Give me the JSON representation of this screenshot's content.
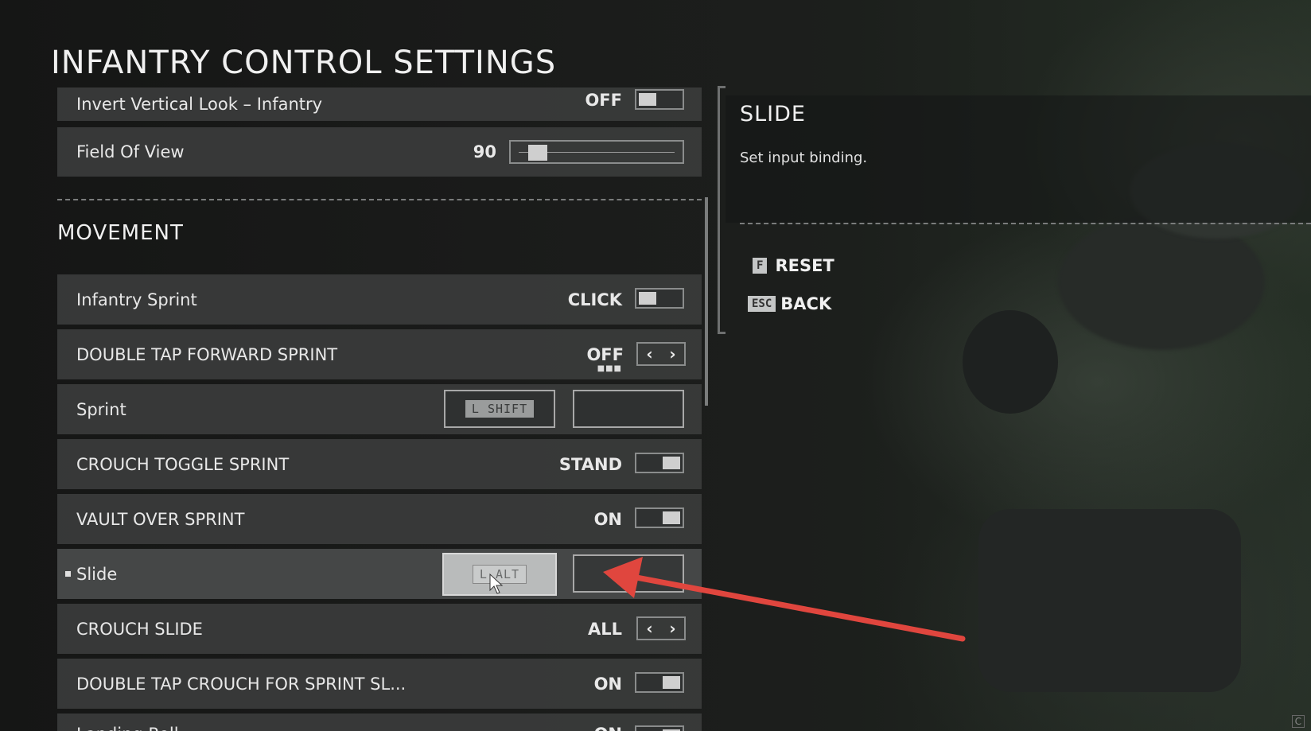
{
  "page": {
    "title": "INFANTRY CONTROL SETTINGS"
  },
  "rows_top": [
    {
      "label": "Invert Vertical Look – Infantry",
      "value": "OFF",
      "control": "toggle",
      "on": false
    },
    {
      "label": "Field Of View",
      "value": "90",
      "control": "slider",
      "level_fraction": 0.12
    }
  ],
  "section": {
    "title": "MOVEMENT"
  },
  "rows": [
    {
      "label": "Infantry Sprint",
      "value": "CLICK",
      "control": "toggle",
      "on": false
    },
    {
      "label": "DOUBLE TAP FORWARD SPRINT",
      "value": "OFF",
      "control": "arrows"
    },
    {
      "label": "Sprint",
      "control": "keybind",
      "primary_key": "L SHIFT",
      "secondary_key": ""
    },
    {
      "label": "CROUCH TOGGLE SPRINT",
      "value": "STAND",
      "control": "toggle",
      "on": true
    },
    {
      "label": "VAULT OVER SPRINT",
      "value": "ON",
      "control": "toggle",
      "on": true
    },
    {
      "label": "Slide",
      "control": "keybind",
      "primary_key": "L ALT",
      "secondary_key": "",
      "selected": true
    },
    {
      "label": "CROUCH SLIDE",
      "value": "ALL",
      "control": "arrows"
    },
    {
      "label": "DOUBLE TAP CROUCH FOR SPRINT SL...",
      "value": "ON",
      "control": "toggle",
      "on": true
    },
    {
      "label": "Landing Roll",
      "value": "ON",
      "control": "toggle",
      "on": true
    }
  ],
  "arrows": {
    "left": "‹",
    "right": "›"
  },
  "panel": {
    "title": "SLIDE",
    "description": "Set input binding.",
    "actions": [
      {
        "key": "F",
        "label": "RESET"
      },
      {
        "key": "ESC",
        "label": "BACK"
      }
    ]
  },
  "corner": {
    "key": "C"
  },
  "colors": {
    "annotation_arrow": "#e0463e",
    "row_bg": "#3e4040"
  }
}
